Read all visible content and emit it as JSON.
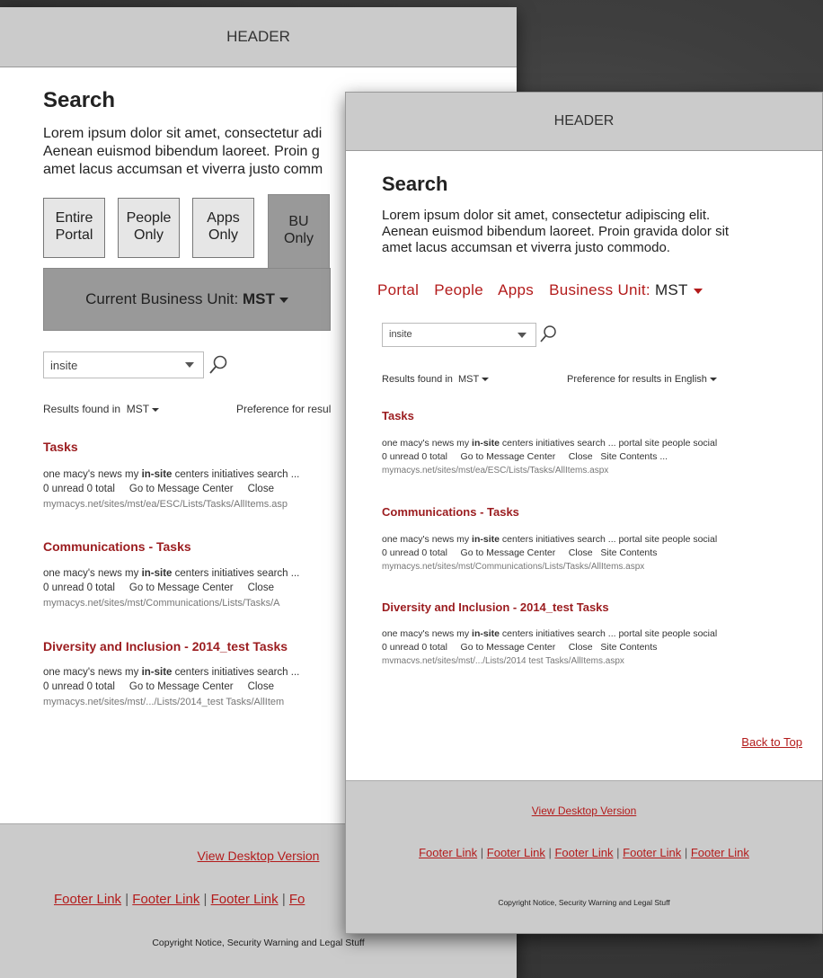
{
  "header": "HEADER",
  "search_title": "Search",
  "intro_lines": [
    "Lorem ipsum dolor sit amet, consectetur adipiscing elit.",
    "Aenean euismod bibendum laoreet. Proin gravida dolor sit",
    "amet lacus accumsan et viverra justo commodo."
  ],
  "desktop": {
    "intro_lines": [
      "Lorem ipsum dolor sit amet, consectetur adi",
      "Aenean euismod bibendum laoreet. Proin g",
      "amet lacus accumsan et viverra justo comm"
    ],
    "scope_buttons": [
      {
        "line1": "Entire",
        "line2": "Portal"
      },
      {
        "line1": "People",
        "line2": "Only"
      },
      {
        "line1": "Apps",
        "line2": "Only"
      },
      {
        "line1": "BU",
        "line2": "Only"
      }
    ],
    "bu_label": "Current Business Unit:",
    "bu_value": "MST",
    "results_found_prefix": "Preference for resul",
    "result_line1": "one macy's news my",
    "result_bold": "in-site",
    "result_line1_rest": "centers initiatives search ...",
    "result_line2": "0 unread 0 total     Go to Message Center     Close",
    "urls": [
      "mymacys.net/sites/mst/ea/ESC/Lists/Tasks/AllItems.asp",
      "mymacys.net/sites/mst/Communications/Lists/Tasks/A",
      "mymacys.net/sites/mst/.../Lists/2014_test Tasks/AllItem"
    ],
    "footer_links_visible": [
      "Footer Link",
      "Footer Link",
      "Footer Link",
      "Fo"
    ]
  },
  "mobile": {
    "tabs": [
      "Portal",
      "People",
      "Apps"
    ],
    "bu_label": "Business Unit:",
    "bu_value": "MST",
    "preference_label": "Preference for results in",
    "preference_value": "English",
    "result_line1_rest": "centers initiatives search ... portal site people social",
    "result_line2_variants": [
      "0 unread 0 total     Go to Message Center     Close   Site Contents ...",
      "0 unread 0 total     Go to Message Center     Close   Site Contents",
      "0 unread 0 total     Go to Message Center     Close   Site Contents"
    ],
    "urls": [
      "mymacys.net/sites/mst/ea/ESC/Lists/Tasks/AllItems.aspx",
      "mymacys.net/sites/mst/Communications/Lists/Tasks/AllItems.aspx",
      "mvmacvs.net/sites/mst/.../Lists/2014 test Tasks/AllItems.aspx"
    ],
    "back_to_top": "Back to Top",
    "footer_links": [
      "Footer Link",
      "Footer Link",
      "Footer Link",
      "Footer Link",
      "Footer Link"
    ]
  },
  "search_value": "insite",
  "results_found_label": "Results found in",
  "results_found_value": "MST",
  "result_titles": [
    "Tasks",
    "Communications - Tasks",
    "Diversity and Inclusion - 2014_test Tasks"
  ],
  "view_desktop": "View Desktop Version",
  "copyright": "Copyright Notice, Security Warning and Legal Stuff",
  "pipe": "|",
  "colors": {
    "accent_red": "#9b1c1f",
    "link_red": "#b31b1b",
    "header_gray": "#cbcbcb",
    "button_gray": "#999999"
  }
}
